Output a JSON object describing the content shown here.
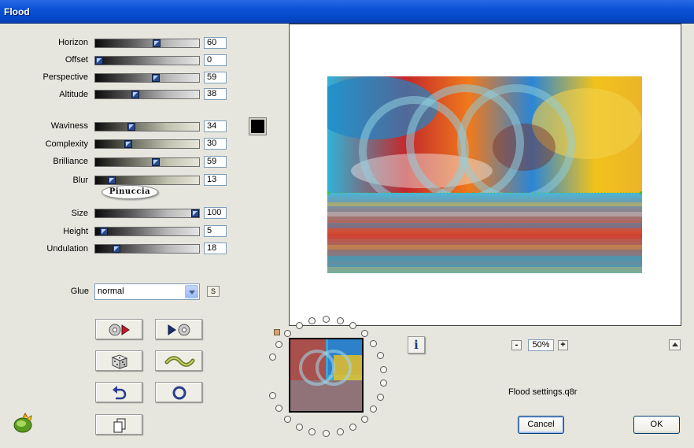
{
  "window": {
    "title": "Flood"
  },
  "params": [
    {
      "label": "Horizon",
      "value": "60",
      "fraction": 0.6,
      "track": "gray"
    },
    {
      "label": "Offset",
      "value": "0",
      "fraction": 0.0,
      "track": "gray"
    },
    {
      "label": "Perspective",
      "value": "59",
      "fraction": 0.59,
      "track": "gray"
    },
    {
      "label": "Altitude",
      "value": "38",
      "fraction": 0.38,
      "track": "gray"
    },
    {
      "label": "Waviness",
      "value": "34",
      "fraction": 0.34,
      "track": "tan"
    },
    {
      "label": "Complexity",
      "value": "30",
      "fraction": 0.3,
      "track": "tan"
    },
    {
      "label": "Brilliance",
      "value": "59",
      "fraction": 0.59,
      "track": "tan"
    },
    {
      "label": "Blur",
      "value": "13",
      "fraction": 0.13,
      "track": "tan"
    },
    {
      "label": "Size",
      "value": "100",
      "fraction": 1.0,
      "track": "gray"
    },
    {
      "label": "Height",
      "value": "5",
      "fraction": 0.05,
      "track": "gray"
    },
    {
      "label": "Undulation",
      "value": "18",
      "fraction": 0.18,
      "track": "gray"
    }
  ],
  "color": {
    "value": "#000000"
  },
  "watermark": {
    "text": "Pinuccia"
  },
  "glue": {
    "label": "Glue",
    "value": "normal",
    "s_label": "S"
  },
  "tools": [
    "load-preset-icon",
    "save-preset-icon",
    "randomize-dice-icon",
    "wave-preview-icon",
    "undo-icon",
    "reset-icon",
    "copy-icon"
  ],
  "zoom": {
    "minus": "-",
    "plus": "+",
    "value": "50%"
  },
  "settings": {
    "filename": "Flood settings.q8r"
  },
  "buttons": {
    "cancel": "Cancel",
    "ok": "OK"
  },
  "colors": {
    "title_bar": "#0a52d6",
    "thumb_blue": "#2a4a8c",
    "dialog_bg": "#e7e6de"
  }
}
